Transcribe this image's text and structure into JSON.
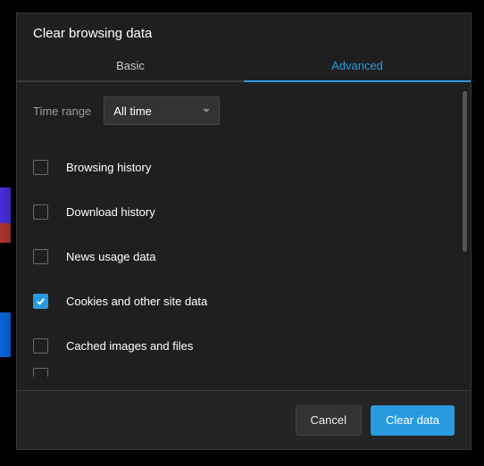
{
  "dialog": {
    "title": "Clear browsing data",
    "tabs": {
      "basic": "Basic",
      "advanced": "Advanced",
      "active": "advanced"
    },
    "timeRange": {
      "label": "Time range",
      "selected": "All time"
    },
    "items": [
      {
        "label": "Browsing history",
        "checked": false
      },
      {
        "label": "Download history",
        "checked": false
      },
      {
        "label": "News usage data",
        "checked": false
      },
      {
        "label": "Cookies and other site data",
        "checked": true
      },
      {
        "label": "Cached images and files",
        "checked": false
      }
    ],
    "buttons": {
      "cancel": "Cancel",
      "confirm": "Clear data"
    }
  }
}
